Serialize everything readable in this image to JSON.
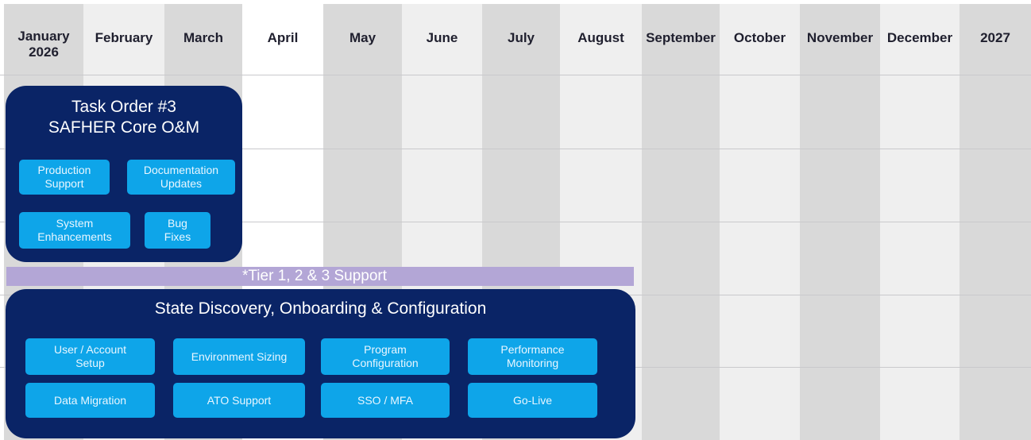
{
  "colors": {
    "col_light": "#efefef",
    "col_dark": "#d9d9d9",
    "col_white": "#ffffff",
    "box_navy": "#0a2466",
    "chip_blue": "#0ea5e9",
    "support_purple": "#b3a6d6"
  },
  "columns": [
    {
      "label": "January\n2026",
      "shade": "col_dark"
    },
    {
      "label": "February",
      "shade": "col_light"
    },
    {
      "label": "March",
      "shade": "col_dark"
    },
    {
      "label": "April",
      "shade": "col_white"
    },
    {
      "label": "May",
      "shade": "col_dark"
    },
    {
      "label": "June",
      "shade": "col_light"
    },
    {
      "label": "July",
      "shade": "col_dark"
    },
    {
      "label": "August",
      "shade": "col_light"
    },
    {
      "label": "September",
      "shade": "col_dark"
    },
    {
      "label": "October",
      "shade": "col_light"
    },
    {
      "label": "November",
      "shade": "col_dark"
    },
    {
      "label": "December",
      "shade": "col_light"
    },
    {
      "label": "2027",
      "shade": "col_dark"
    }
  ],
  "task_order": {
    "title": "Task Order #3\nSAFHER Core O&M",
    "items": [
      "Production\nSupport",
      "Documentation\nUpdates",
      "System\nEnhancements",
      "Bug\nFixes"
    ]
  },
  "support_bar": {
    "label": "*Tier 1, 2 & 3 Support"
  },
  "discovery": {
    "title": "State Discovery, Onboarding & Configuration",
    "items": [
      "User / Account\nSetup",
      "Environment Sizing",
      "Program\nConfiguration",
      "Performance\nMonitoring",
      "Data Migration",
      "ATO Support",
      "SSO / MFA",
      "Go-Live"
    ]
  }
}
